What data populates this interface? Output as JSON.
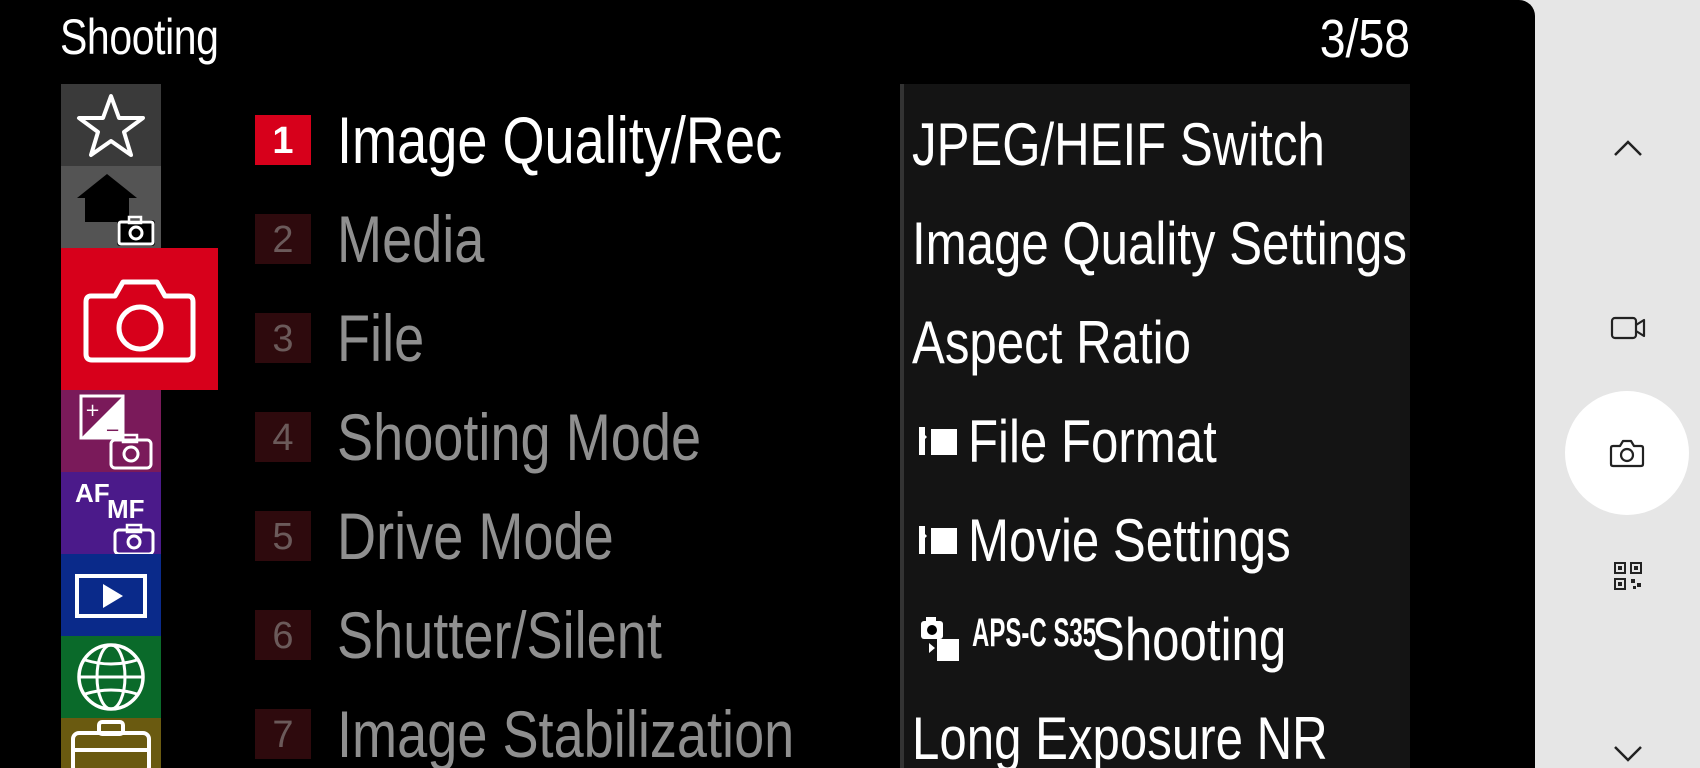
{
  "header": {
    "title": "Shooting",
    "page_counter": "3/58"
  },
  "tabs": [
    {
      "name": "my-menu",
      "icon": "star-icon",
      "color": "#3a3a3a"
    },
    {
      "name": "main",
      "icon": "home-camera-icon",
      "color": "#545454"
    },
    {
      "name": "shooting",
      "icon": "camera-icon",
      "color": "#d7001b",
      "active": true
    },
    {
      "name": "exposure-color",
      "icon": "exposure-camera-icon",
      "color": "#7a1a5a"
    },
    {
      "name": "focus",
      "icon": "af-mf-icon",
      "color": "#4b1a8a",
      "text_af": "AF",
      "text_mf": "MF"
    },
    {
      "name": "playback",
      "icon": "playback-icon",
      "color": "#0a2a8a"
    },
    {
      "name": "network",
      "icon": "globe-icon",
      "color": "#0a6a2a"
    },
    {
      "name": "setup",
      "icon": "toolbox-icon",
      "color": "#6a5a10"
    }
  ],
  "groups": [
    {
      "number": "1",
      "label": "Image Quality/Rec",
      "active": true
    },
    {
      "number": "2",
      "label": "Media"
    },
    {
      "number": "3",
      "label": "File"
    },
    {
      "number": "4",
      "label": "Shooting Mode"
    },
    {
      "number": "5",
      "label": "Drive Mode"
    },
    {
      "number": "6",
      "label": "Shutter/Silent"
    },
    {
      "number": "7",
      "label": "Image Stabilization"
    }
  ],
  "items": [
    {
      "label": "JPEG/HEIF Switch"
    },
    {
      "label": "Image Quality Settings"
    },
    {
      "label": "Aspect Ratio"
    },
    {
      "label": "File Format",
      "icon": "movie-mode-icon"
    },
    {
      "label": "Movie Settings",
      "icon": "movie-mode-icon"
    },
    {
      "label": "Shooting",
      "icon": "still-movie-icon",
      "tag": "APS-C S35"
    },
    {
      "label": "Long Exposure NR"
    }
  ],
  "rail": {
    "up": "chevron-up-icon",
    "video": "video-icon",
    "shutter": "camera-icon",
    "qr": "qr-code-icon",
    "down": "chevron-down-icon"
  }
}
